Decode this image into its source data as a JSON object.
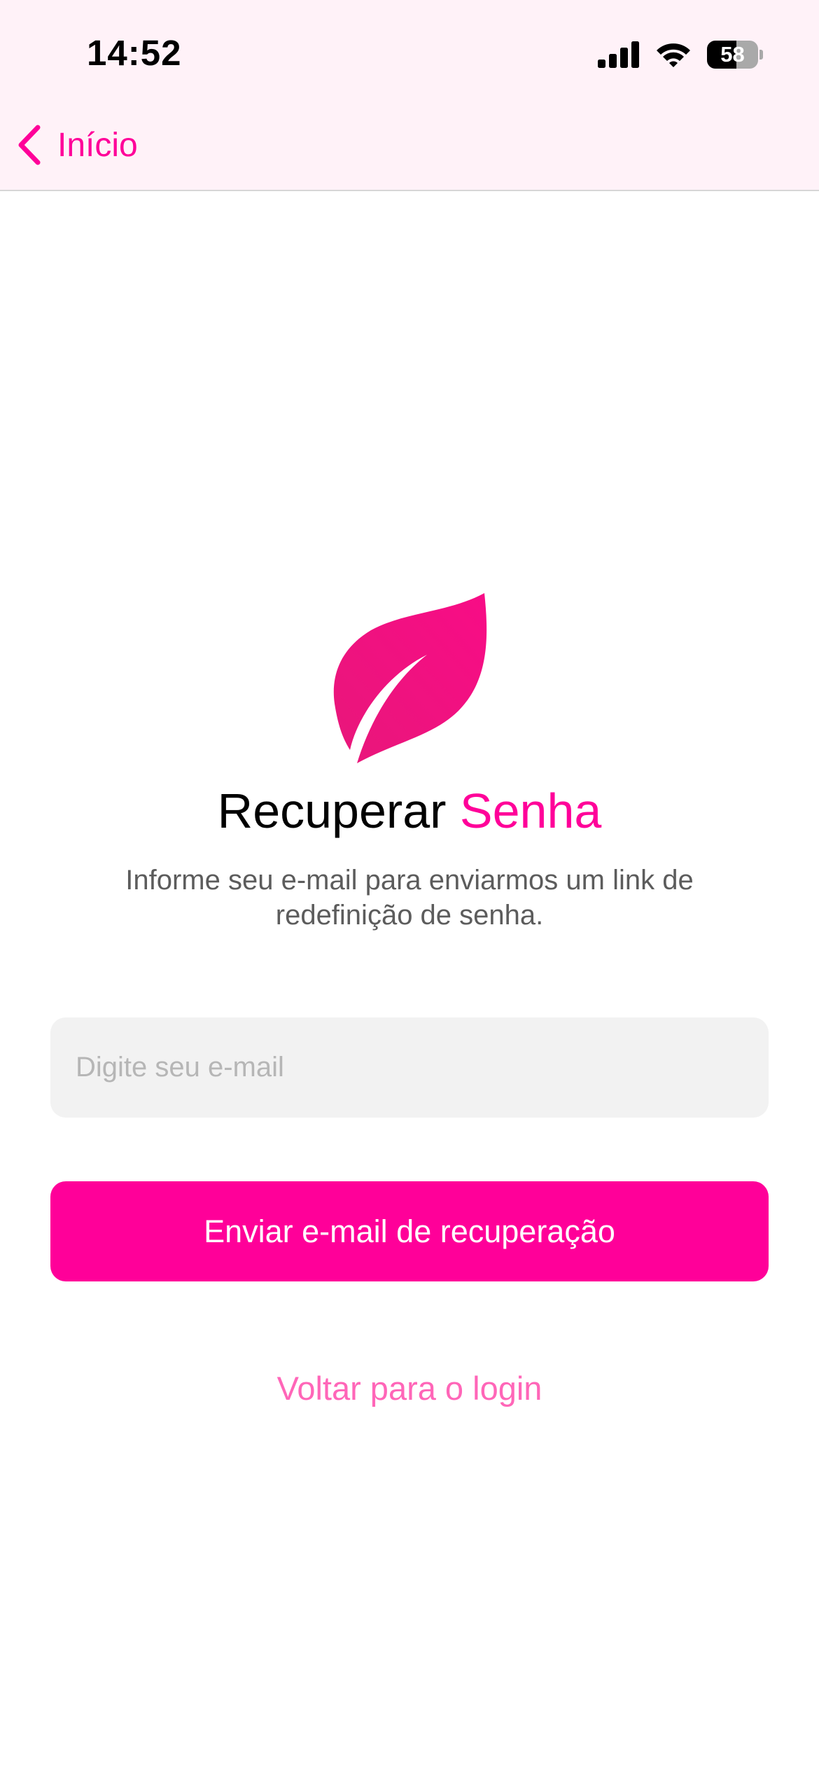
{
  "status_bar": {
    "time": "14:52",
    "battery_level": "58",
    "battery_fraction": 0.58
  },
  "nav": {
    "back_label": "Início"
  },
  "title": {
    "main": "Recuperar",
    "accent": "Senha"
  },
  "subtitle": "Informe seu e-mail para enviarmos um link de redefinição de senha.",
  "email_field": {
    "placeholder": "Digite seu e-mail",
    "value": ""
  },
  "send_button_label": "Enviar e-mail de recuperação",
  "back_to_login_label": "Voltar para o login",
  "colors": {
    "accent": "#ff0099",
    "header_bg": "#fff2f8",
    "link": "#ff66b8",
    "input_bg": "#f2f2f2"
  },
  "icons": {
    "logo": "leaf-icon",
    "back": "chevron-left-icon",
    "signal": "cellular-signal-icon",
    "wifi": "wifi-icon",
    "battery": "battery-icon"
  }
}
